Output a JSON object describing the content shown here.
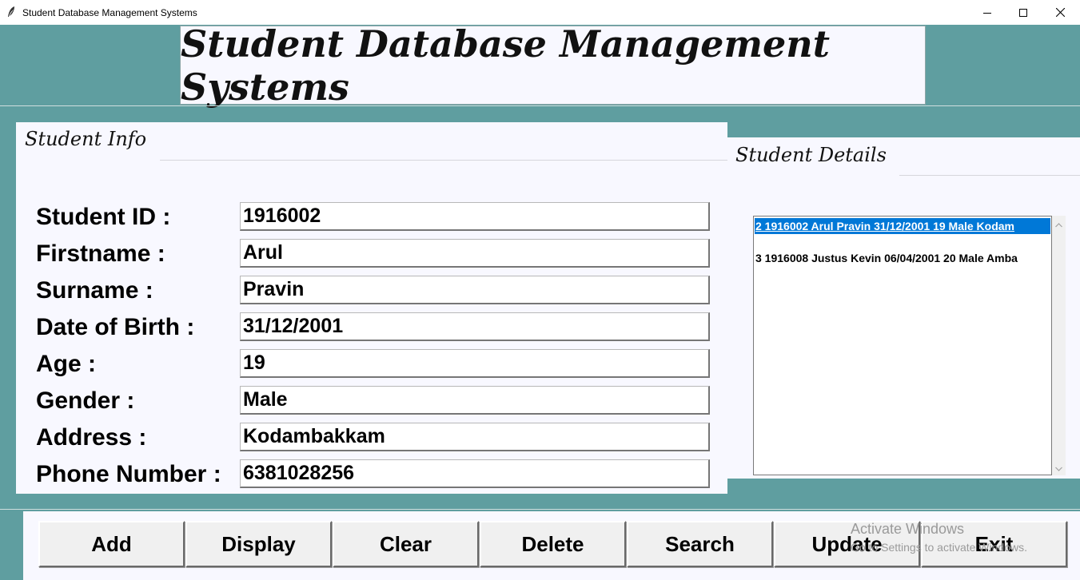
{
  "window": {
    "title": "Student Database Management Systems",
    "icon": "feather-icon",
    "controls": [
      "minimize-icon",
      "maximize-icon",
      "close-icon"
    ]
  },
  "header": {
    "title": "Student Database Management Systems"
  },
  "student_info": {
    "caption": "Student Info",
    "fields": [
      {
        "label": "Student ID :",
        "value": "1916002"
      },
      {
        "label": "Firstname :",
        "value": "Arul"
      },
      {
        "label": "Surname :",
        "value": "Pravin"
      },
      {
        "label": "Date of Birth :",
        "value": "31/12/2001"
      },
      {
        "label": "Age :",
        "value": "19"
      },
      {
        "label": "Gender :",
        "value": "Male"
      },
      {
        "label": "Address :",
        "value": "Kodambakkam"
      },
      {
        "label": "Phone Number :",
        "value": "6381028256"
      }
    ]
  },
  "student_details": {
    "caption": "Student Details",
    "records": [
      {
        "text": "2 1916002 Arul Pravin 31/12/2001 19 Male Kodam",
        "selected": true
      },
      {
        "text": "3 1916008 Justus Kevin 06/04/2001 20 Male Amba",
        "selected": false
      }
    ]
  },
  "buttons": {
    "add": "Add",
    "display": "Display",
    "clear": "Clear",
    "delete": "Delete",
    "search": "Search",
    "update": "Update",
    "exit": "Exit"
  },
  "watermark": {
    "line1": "Activate Windows",
    "line2": "Go to Settings to activate Windows."
  },
  "colors": {
    "background": "#5f9ea0",
    "panel": "#f8f8ff",
    "selection": "#0078d7"
  }
}
